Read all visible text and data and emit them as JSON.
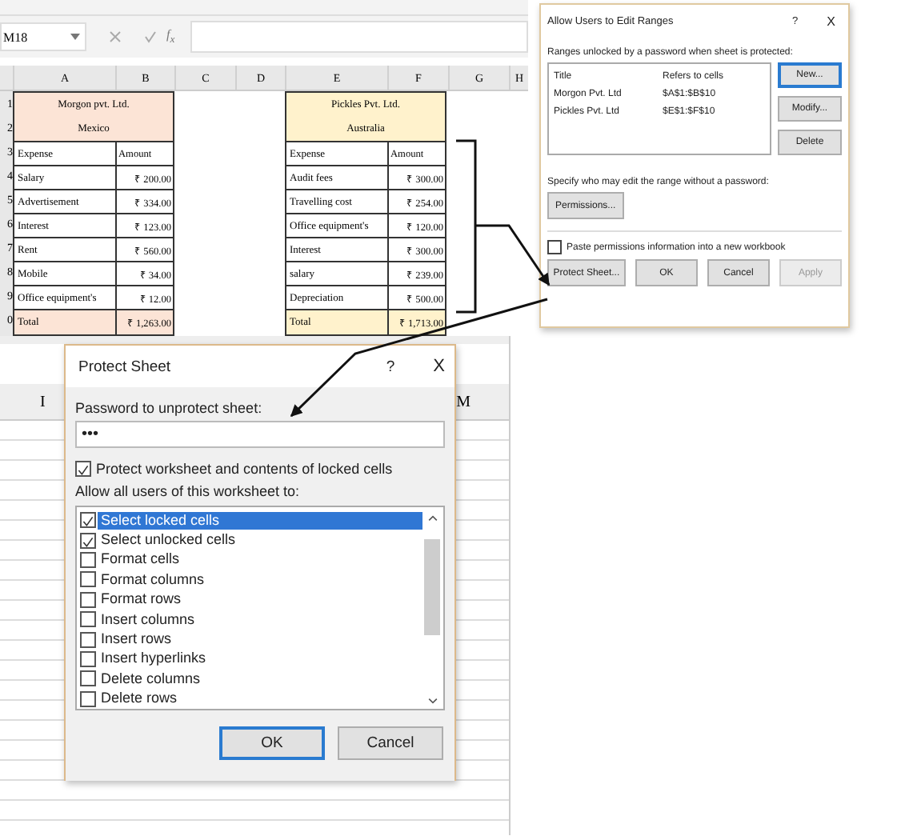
{
  "sheet": {
    "name_box": "M18",
    "fx_label": "f$_{x}$",
    "columns": [
      "A",
      "B",
      "C",
      "D",
      "E",
      "F",
      "G",
      "H"
    ],
    "row_numbers": [
      "1",
      "2",
      "3",
      "4",
      "5",
      "6",
      "7",
      "8",
      "9",
      "0"
    ],
    "tables": [
      {
        "title": "Morgon pvt. Ltd.",
        "subtitle": "Mexico",
        "color": "#fce4d6",
        "headers": [
          "Expense",
          "Amount"
        ],
        "rows": [
          [
            "Salary",
            "₹ 200.00"
          ],
          [
            "Advertisement",
            "₹ 334.00"
          ],
          [
            "Interest",
            "₹ 123.00"
          ],
          [
            "Rent",
            "₹ 560.00"
          ],
          [
            "Mobile",
            "₹ 34.00"
          ],
          [
            "Office equipment's",
            "₹ 12.00"
          ]
        ],
        "total": [
          "Total",
          "₹ 1,263.00"
        ]
      },
      {
        "title": "Pickles Pvt. Ltd.",
        "subtitle": "Australia",
        "color": "#fff2cc",
        "headers": [
          "Expense",
          "Amount"
        ],
        "rows": [
          [
            "Audit fees",
            "₹ 300.00"
          ],
          [
            "Travelling cost",
            "₹ 254.00"
          ],
          [
            "Office equipment's",
            "₹ 120.00"
          ],
          [
            "Interest",
            "₹ 300.00"
          ],
          [
            "salary",
            "₹ 239.00"
          ],
          [
            "Depreciation",
            "₹ 500.00"
          ]
        ],
        "total": [
          "Total",
          "₹ 1,713.00"
        ]
      }
    ]
  },
  "ranges_dialog": {
    "title": "Allow Users to Edit Ranges",
    "help": "?",
    "close": "X",
    "list_label": "Ranges unlocked by a password when sheet is protected:",
    "columns": [
      "Title",
      "Refers to cells"
    ],
    "ranges": [
      {
        "title": "Morgon Pvt. Ltd",
        "refers_to": "$A$1:$B$10"
      },
      {
        "title": "Pickles Pvt. Ltd",
        "refers_to": "$E$1:$F$10"
      }
    ],
    "side_buttons": [
      {
        "label": "New...",
        "focused": true
      },
      {
        "label": "Modify...",
        "focused": false
      },
      {
        "label": "Delete",
        "focused": false
      }
    ],
    "permissions_label": "Specify who may edit the range without a password:",
    "permissions_button": "Permissions...",
    "paste_option": {
      "label": "Paste permissions information into a new workbook",
      "checked": false
    },
    "buttons": [
      {
        "label": "Protect Sheet...",
        "disabled": false
      },
      {
        "label": "OK",
        "disabled": false
      },
      {
        "label": "Cancel",
        "disabled": false
      },
      {
        "label": "Apply",
        "disabled": true
      }
    ]
  },
  "lower_sheet": {
    "columns": [
      "I",
      "M"
    ]
  },
  "protect_dialog": {
    "title": "Protect Sheet",
    "help": "?",
    "close": "X",
    "password_label": "Password to unprotect sheet:",
    "password_value": "•••",
    "protect_option": {
      "label": "Protect worksheet and contents of locked cells",
      "checked": true
    },
    "allow_label": "Allow all users of this worksheet to:",
    "permissions": [
      {
        "label": "Select locked cells",
        "checked": true,
        "selected": true
      },
      {
        "label": "Select unlocked cells",
        "checked": true,
        "selected": false
      },
      {
        "label": "Format cells",
        "checked": false,
        "selected": false
      },
      {
        "label": "Format columns",
        "checked": false,
        "selected": false
      },
      {
        "label": "Format rows",
        "checked": false,
        "selected": false
      },
      {
        "label": "Insert columns",
        "checked": false,
        "selected": false
      },
      {
        "label": "Insert rows",
        "checked": false,
        "selected": false
      },
      {
        "label": "Insert hyperlinks",
        "checked": false,
        "selected": false
      },
      {
        "label": "Delete columns",
        "checked": false,
        "selected": false
      },
      {
        "label": "Delete rows",
        "checked": false,
        "selected": false
      }
    ],
    "buttons": [
      {
        "label": "OK",
        "focused": true
      },
      {
        "label": "Cancel",
        "focused": false
      }
    ]
  }
}
